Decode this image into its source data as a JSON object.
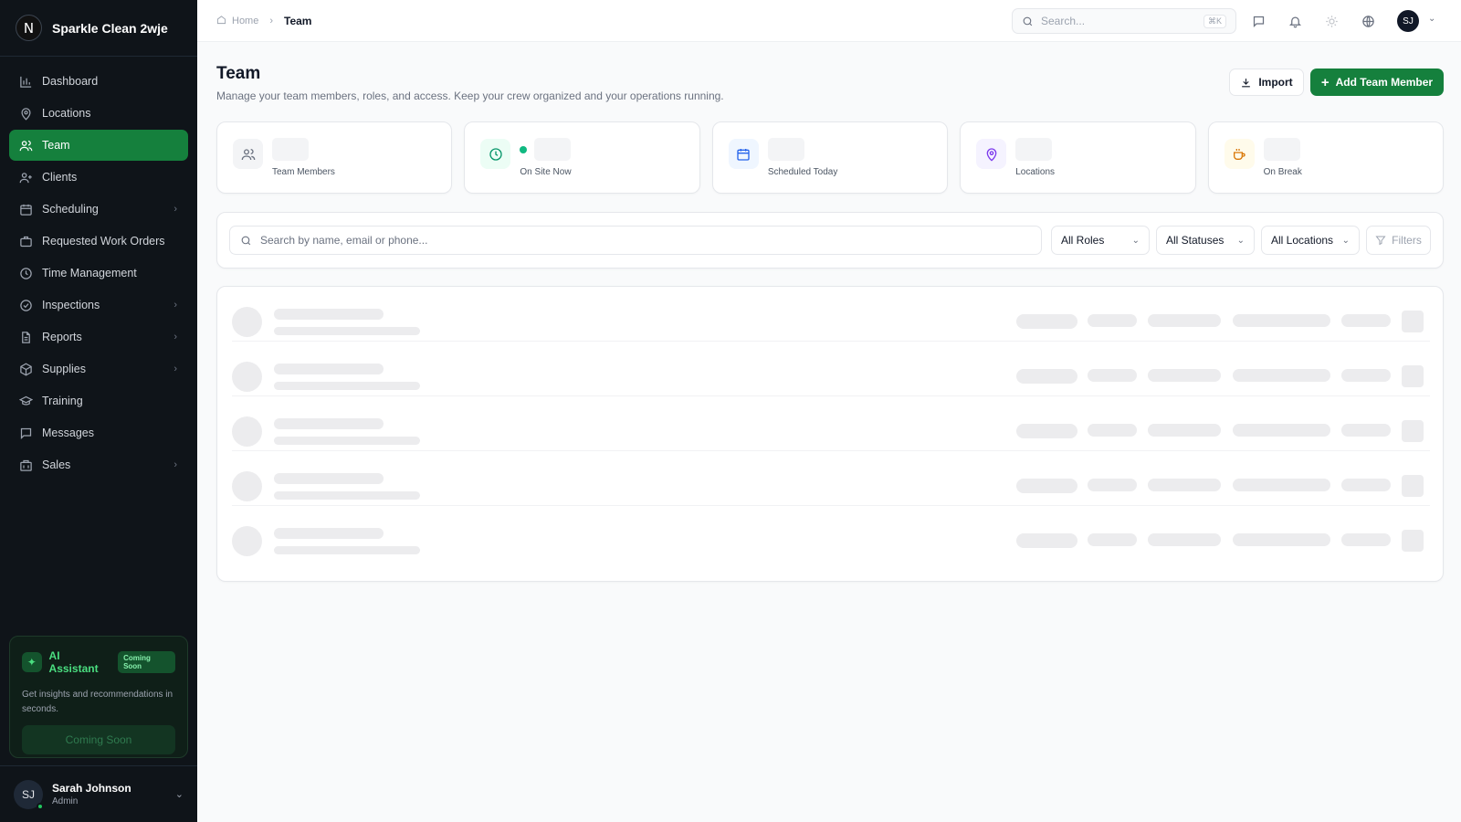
{
  "app": {
    "logo_letter": "N",
    "name": "Sparkle Clean 2wje"
  },
  "sidebar": {
    "items": [
      {
        "label": "Dashboard",
        "icon": "bar-chart-icon",
        "active": false,
        "has_submenu": false
      },
      {
        "label": "Locations",
        "icon": "map-pin-icon",
        "active": false,
        "has_submenu": false
      },
      {
        "label": "Team",
        "icon": "users-icon",
        "active": true,
        "has_submenu": false
      },
      {
        "label": "Clients",
        "icon": "user-plus-icon",
        "active": false,
        "has_submenu": false
      },
      {
        "label": "Scheduling",
        "icon": "calendar-icon",
        "active": false,
        "has_submenu": true
      },
      {
        "label": "Requested Work Orders",
        "icon": "briefcase-icon",
        "active": false,
        "has_submenu": false
      },
      {
        "label": "Time Management",
        "icon": "clock-icon",
        "active": false,
        "has_submenu": false
      },
      {
        "label": "Inspections",
        "icon": "check-circle-icon",
        "active": false,
        "has_submenu": true
      },
      {
        "label": "Reports",
        "icon": "file-text-icon",
        "active": false,
        "has_submenu": true
      },
      {
        "label": "Supplies",
        "icon": "package-icon",
        "active": false,
        "has_submenu": true
      },
      {
        "label": "Training",
        "icon": "graduation-cap-icon",
        "active": false,
        "has_submenu": false
      },
      {
        "label": "Messages",
        "icon": "message-square-icon",
        "active": false,
        "has_submenu": false
      },
      {
        "label": "Sales",
        "icon": "building-icon",
        "active": false,
        "has_submenu": true
      }
    ],
    "ai_card": {
      "title": "AI Assistant",
      "badge": "Coming Soon",
      "description": "Get insights and recommendations in seconds.",
      "button_label": "Coming Soon"
    },
    "user": {
      "initials": "SJ",
      "name": "Sarah Johnson",
      "role": "Admin",
      "status_color": "#22c55e"
    }
  },
  "topbar": {
    "breadcrumb": {
      "home": "Home",
      "current": "Team"
    },
    "search_placeholder": "Search...",
    "search_shortcut": "⌘K",
    "avatar_initials": "SJ"
  },
  "page": {
    "title": "Team",
    "subtitle": "Manage your team members, roles, and access. Keep your crew organized and your operations running.",
    "import_label": "Import",
    "add_label": "Add Team Member"
  },
  "stats": [
    {
      "label": "Team Members",
      "icon": "users-icon",
      "color": "#6b7280",
      "bg": "#f3f4f6"
    },
    {
      "label": "On Site Now",
      "icon": "clock-icon",
      "color": "#059669",
      "bg": "#ecfdf5"
    },
    {
      "label": "Scheduled Today",
      "icon": "calendar-icon",
      "color": "#2563eb",
      "bg": "#eff6ff"
    },
    {
      "label": "Locations",
      "icon": "map-pin-icon",
      "color": "#7c3aed",
      "bg": "#f5f3ff"
    },
    {
      "label": "On Break",
      "icon": "coffee-icon",
      "color": "#d97706",
      "bg": "#fffbeb"
    }
  ],
  "filters": {
    "search_placeholder": "Search by name, email or phone...",
    "roles": "All Roles",
    "statuses": "All Statuses",
    "locations": "All Locations",
    "filters_label": "Filters"
  },
  "colors": {
    "accent": "#15803d",
    "sidebar_bg": "#0f1419"
  }
}
